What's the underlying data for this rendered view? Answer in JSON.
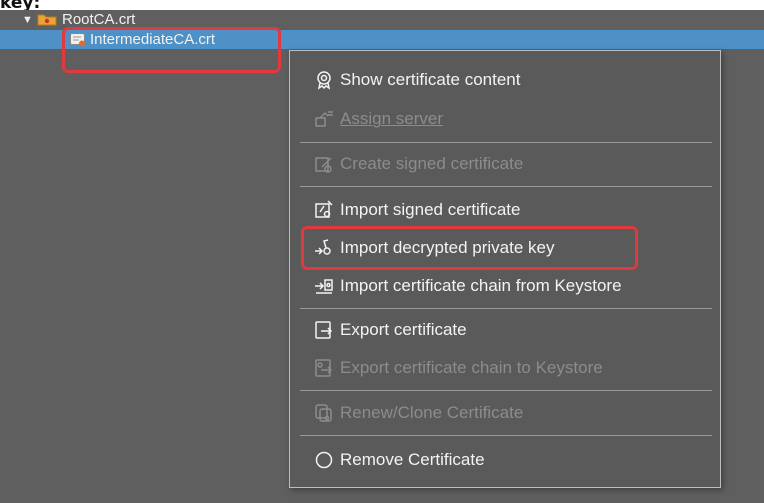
{
  "caption": "key:",
  "tree": {
    "twisty": "▼",
    "root_label": "RootCA.crt",
    "intermediate_label": "IntermediateCA.crt"
  },
  "menu": {
    "items": [
      {
        "label": "Show certificate content",
        "icon": "certificate-icon",
        "enabled": true
      },
      {
        "label": "Assign server",
        "icon": "assign-server-icon",
        "enabled": false
      },
      {
        "label": "Create signed certificate",
        "icon": "sign-icon",
        "enabled": false
      },
      {
        "label": "Import signed certificate",
        "icon": "import-signed-icon",
        "enabled": true
      },
      {
        "label": "Import decrypted private key",
        "icon": "import-key-icon",
        "enabled": true
      },
      {
        "label": "Import certificate chain from Keystore",
        "icon": "import-chain-icon",
        "enabled": true
      },
      {
        "label": "Export certificate",
        "icon": "export-icon",
        "enabled": true
      },
      {
        "label": "Export certificate chain to Keystore",
        "icon": "export-chain-icon",
        "enabled": false
      },
      {
        "label": "Renew/Clone Certificate",
        "icon": "renew-icon",
        "enabled": false
      },
      {
        "label": "Remove Certificate",
        "icon": "remove-icon",
        "enabled": true
      }
    ]
  },
  "colors": {
    "panel": "#5f5f5f",
    "selection": "#4e91c6",
    "menu_bg": "#5a5a5a",
    "highlight": "#e0393e",
    "disabled_text": "#8c8c8c"
  }
}
